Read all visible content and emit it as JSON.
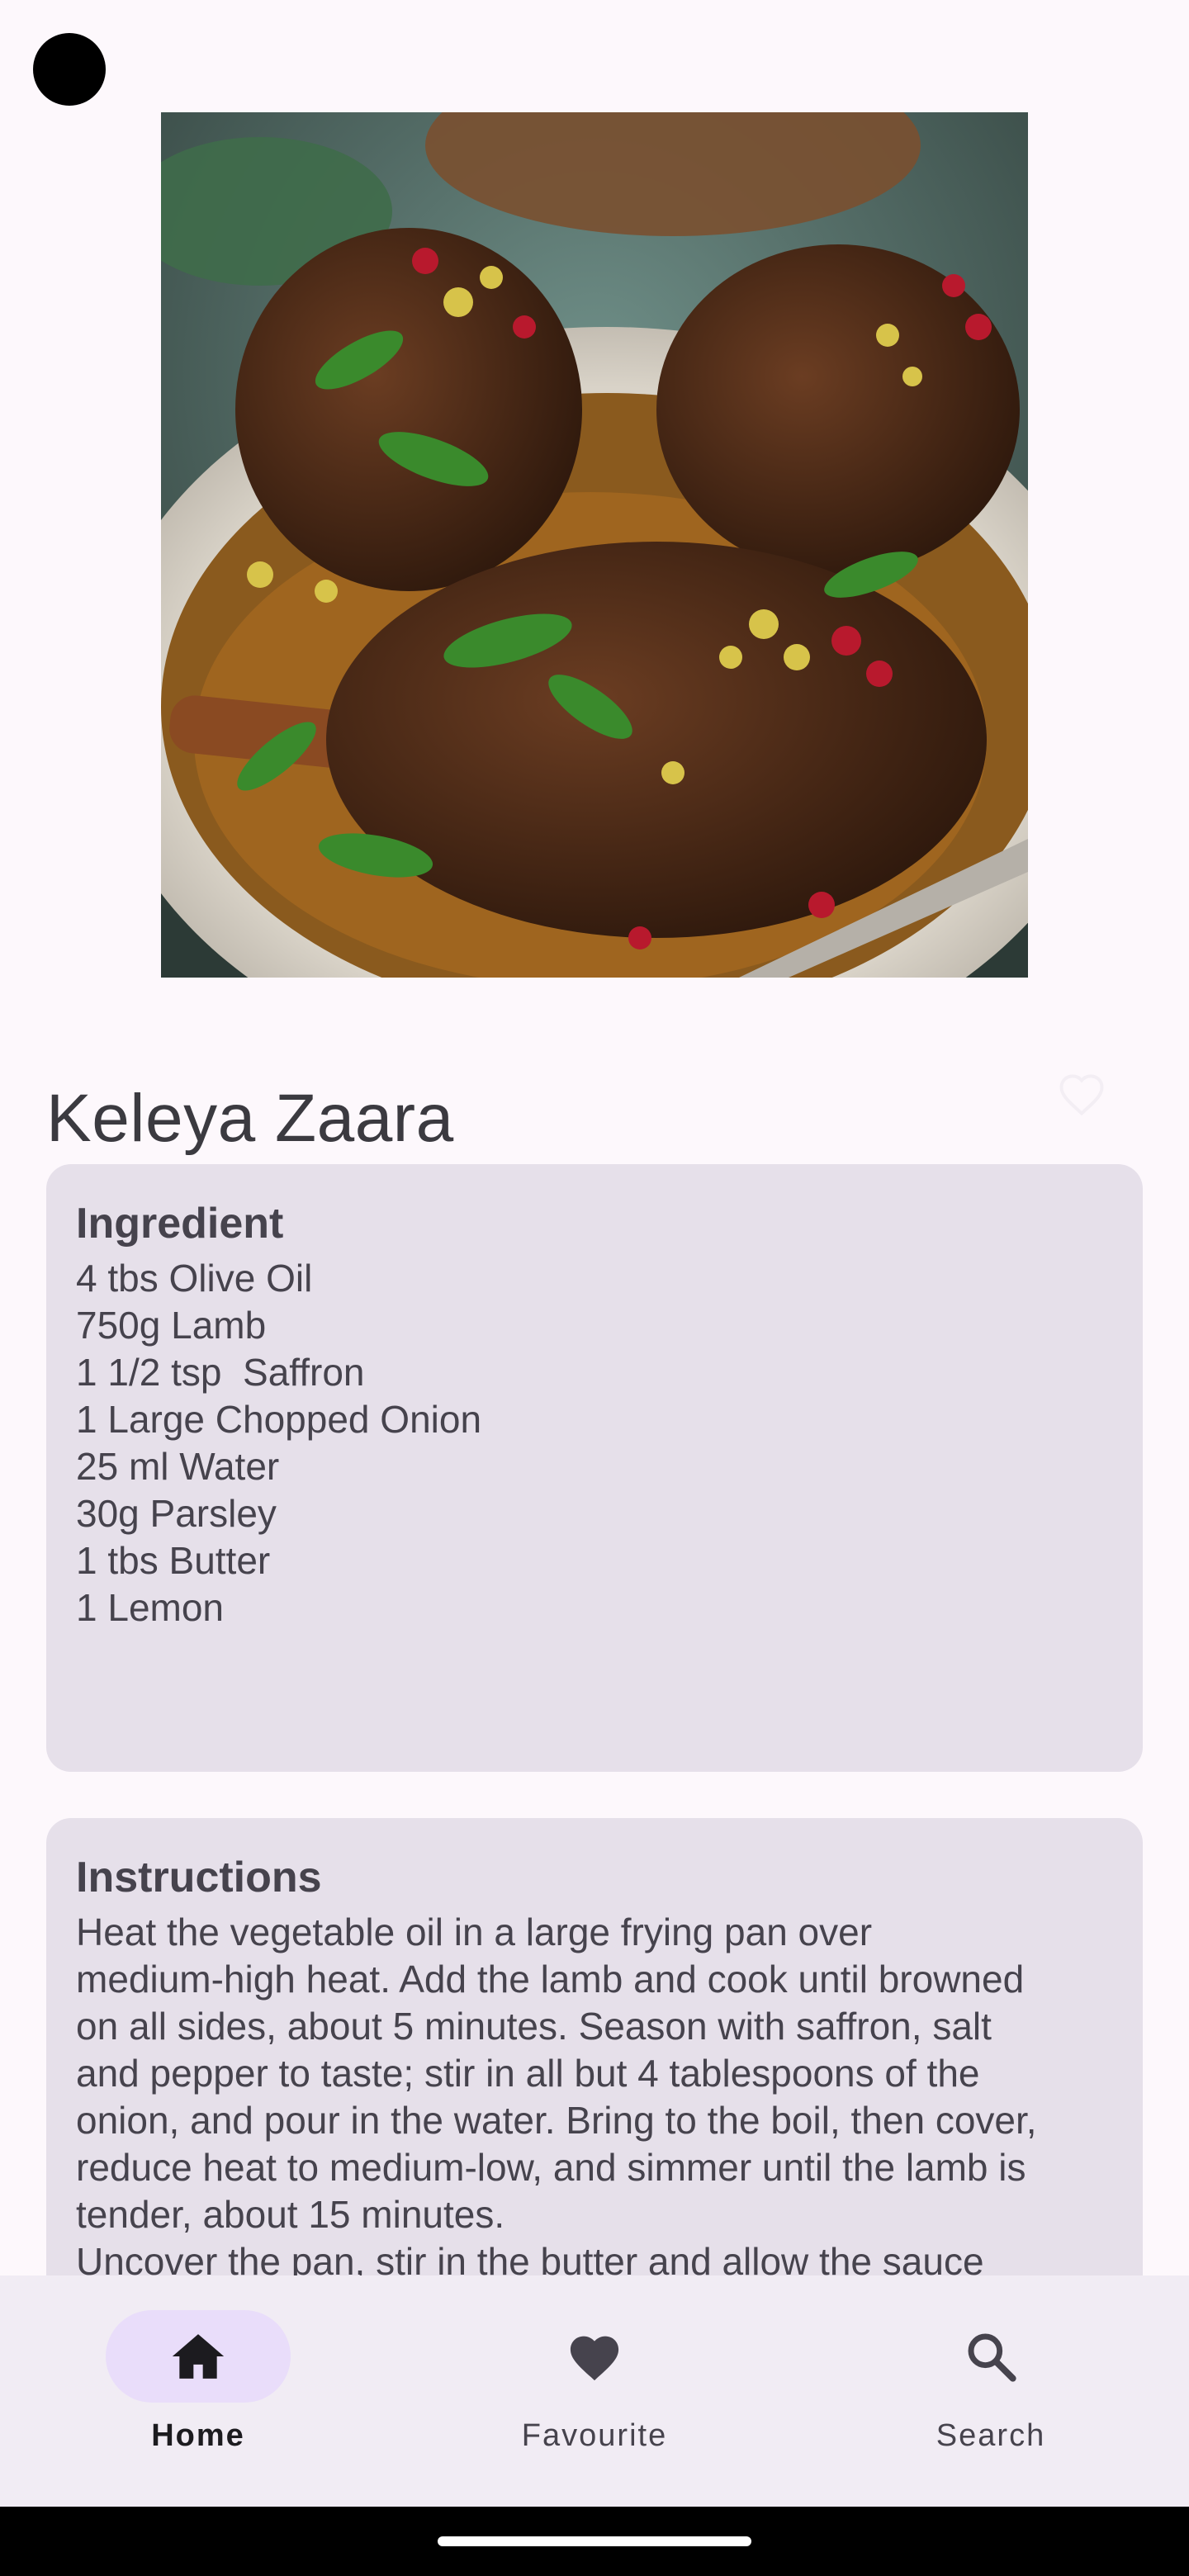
{
  "recipe": {
    "title": "Keleya Zaara",
    "ingredients_heading": "Ingredient",
    "ingredients": [
      "4 tbs Olive Oil",
      "750g Lamb",
      "1 1/2 tsp  Saffron",
      "1 Large Chopped Onion",
      "25 ml Water",
      "30g Parsley",
      "1 tbs Butter",
      "1 Lemon"
    ],
    "instructions_heading": "Instructions",
    "instructions": "Heat the vegetable oil in a large frying pan over\nmedium-high heat. Add the lamb and cook until browned\non all sides, about 5 minutes. Season with saffron, salt\nand pepper to taste; stir in all but 4 tablespoons of the\nonion, and pour in the water. Bring to the boil, then cover,\nreduce heat to medium-low, and simmer until the lamb is\ntender, about 15 minutes.\nUncover the pan, stir in the butter and allow the sauce"
  },
  "bottom_nav": {
    "items": [
      {
        "label": "Home",
        "icon": "home-icon",
        "active": true
      },
      {
        "label": "Favourite",
        "icon": "heart-icon",
        "active": false
      },
      {
        "label": "Search",
        "icon": "search-icon",
        "active": false
      }
    ]
  },
  "colors": {
    "background": "#FDF8FC",
    "card": "#E6E0EA",
    "nav_background": "#F1ECF4",
    "nav_indicator": "#E9DDFA",
    "text": "#46434D"
  }
}
